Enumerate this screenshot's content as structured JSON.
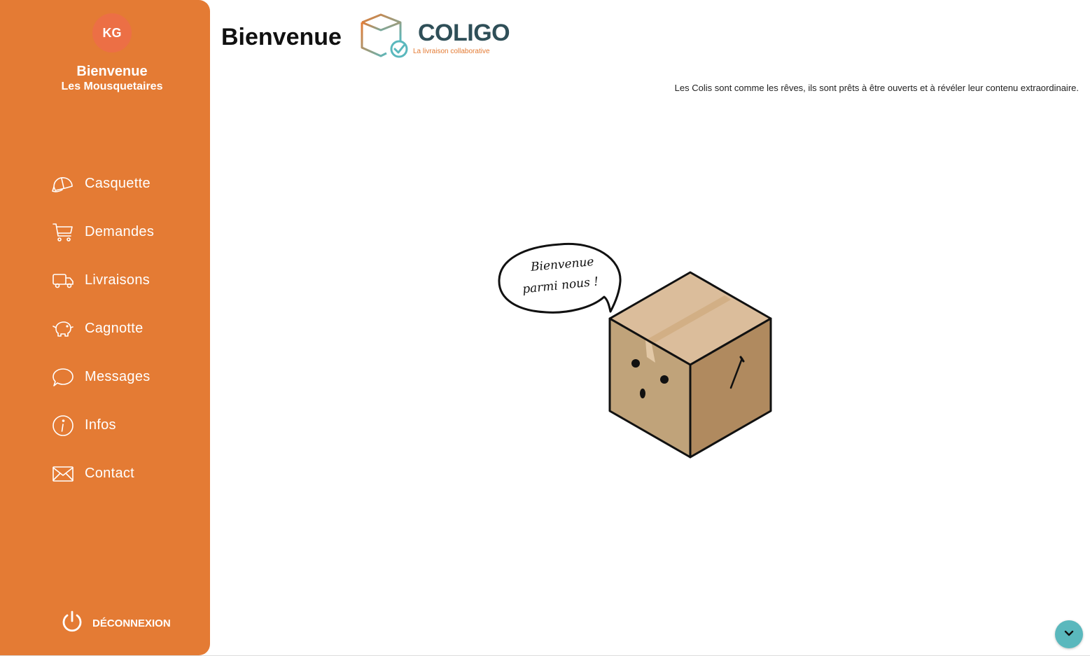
{
  "sidebar": {
    "avatar_initials": "KG",
    "welcome_title": "Bienvenue",
    "welcome_user": "Les Mousquetaires",
    "items": [
      {
        "label": "Casquette",
        "icon": "cap-icon"
      },
      {
        "label": "Demandes",
        "icon": "cart-icon"
      },
      {
        "label": "Livraisons",
        "icon": "truck-icon"
      },
      {
        "label": "Cagnotte",
        "icon": "piggy-bank-icon"
      },
      {
        "label": "Messages",
        "icon": "chat-bubble-icon"
      },
      {
        "label": "Infos",
        "icon": "info-icon"
      },
      {
        "label": "Contact",
        "icon": "envelope-icon"
      }
    ],
    "logout_label": "DÉCONNEXION"
  },
  "header": {
    "title": "Bienvenue",
    "logo_brand": "COLIGO",
    "logo_tagline": "La livraison collaborative"
  },
  "main": {
    "quote": "Les Colis sont comme les rêves, ils sont prêts à être ouverts et à révéler leur contenu extraordinaire.",
    "bubble_line1": "Bienvenue",
    "bubble_line2": "parmi nous !"
  },
  "colors": {
    "sidebar": "#e47b34",
    "avatar": "#ec6f45",
    "scroll_button": "#5ab8bd",
    "brand_text": "#2f4f58"
  }
}
